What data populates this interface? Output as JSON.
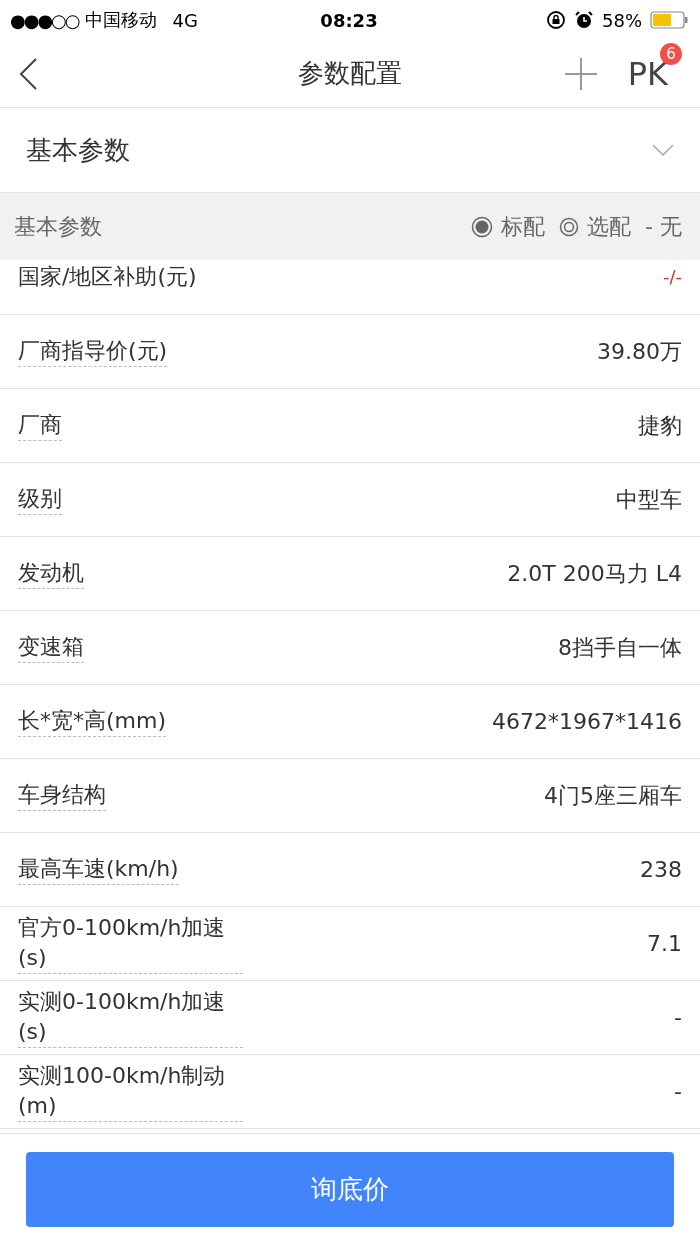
{
  "status_bar": {
    "signal_dots": "●●●○○",
    "carrier": "中国移动",
    "network": "4G",
    "time": "08:23",
    "battery_text": "58%"
  },
  "nav": {
    "title": "参数配置",
    "pk": "PK",
    "pk_badge": "6"
  },
  "dropdown": {
    "label": "基本参数",
    "expanded": false
  },
  "section": {
    "title": "基本参数",
    "legend": [
      {
        "kind": "standard",
        "label": "标配"
      },
      {
        "kind": "optional",
        "label": "选配"
      },
      {
        "kind": "none",
        "label": "- 无"
      }
    ]
  },
  "rows": [
    {
      "label": "国家/地区补助(元)",
      "value": "-/-",
      "tip": false,
      "emphasis": true,
      "partial": true
    },
    {
      "label": "厂商指导价(元)",
      "value": "39.80万",
      "tip": true,
      "emphasis": false,
      "partial": false
    },
    {
      "label": "厂商",
      "value": "捷豹",
      "tip": true,
      "emphasis": false,
      "partial": false
    },
    {
      "label": "级别",
      "value": "中型车",
      "tip": true,
      "emphasis": false,
      "partial": false
    },
    {
      "label": "发动机",
      "value": "2.0T 200马力 L4",
      "tip": true,
      "emphasis": false,
      "partial": false
    },
    {
      "label": "变速箱",
      "value": "8挡手自一体",
      "tip": true,
      "emphasis": false,
      "partial": false
    },
    {
      "label": "长*宽*高(mm)",
      "value": "4672*1967*1416",
      "tip": true,
      "emphasis": false,
      "partial": false
    },
    {
      "label": "车身结构",
      "value": "4门5座三厢车",
      "tip": true,
      "emphasis": false,
      "partial": false
    },
    {
      "label": "最高车速(km/h)",
      "value": "238",
      "tip": true,
      "emphasis": false,
      "partial": false
    },
    {
      "label": "官方0-100km/h加速(s)",
      "value": "7.1",
      "tip": true,
      "emphasis": false,
      "partial": false
    },
    {
      "label": "实测0-100km/h加速(s)",
      "value": "-",
      "tip": true,
      "emphasis": false,
      "partial": false
    },
    {
      "label": "实测100-0km/h制动(m)",
      "value": "-",
      "tip": true,
      "emphasis": false,
      "partial": false
    }
  ],
  "action_button": "询底价"
}
